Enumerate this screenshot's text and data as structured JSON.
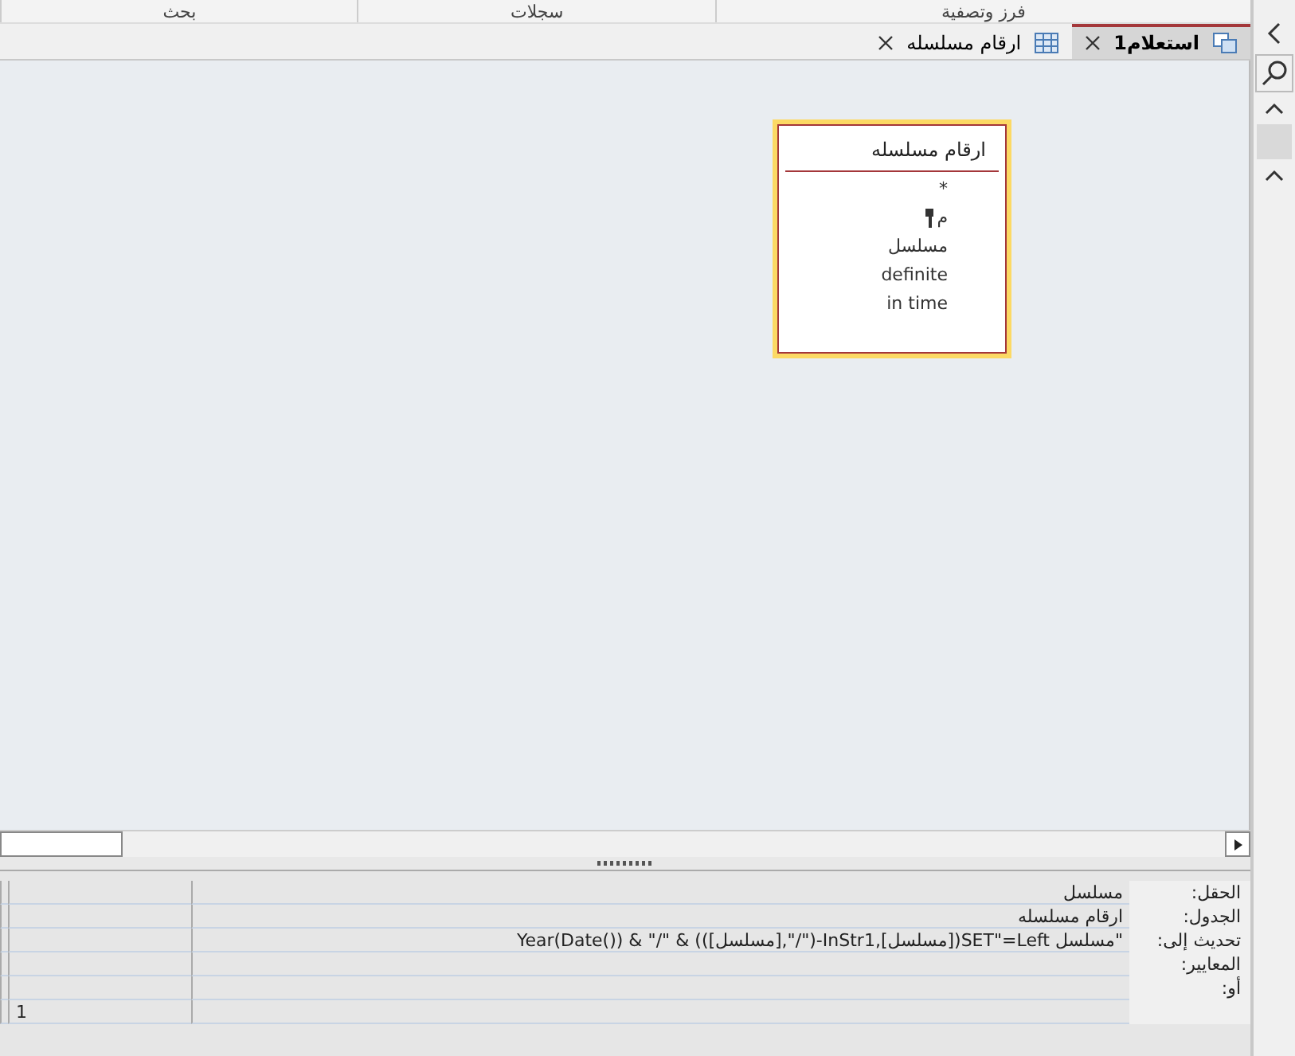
{
  "ribbon_groups": [
    "فرز وتصفية",
    "سجلات",
    "بحث"
  ],
  "tabs": [
    {
      "label": "استعلام1",
      "kind": "query",
      "selected": true
    },
    {
      "label": "ارقام مسلسله",
      "kind": "table",
      "selected": false
    }
  ],
  "field_list": {
    "title": "ارقام مسلسله",
    "fields": [
      {
        "name": "*",
        "primary_key": false
      },
      {
        "name": "م",
        "primary_key": true
      },
      {
        "name": "مسلسل",
        "primary_key": false
      },
      {
        "name": "definite",
        "primary_key": false
      },
      {
        "name": "in time",
        "primary_key": false
      }
    ]
  },
  "grid": {
    "rows": [
      {
        "label": "الحقل:",
        "column_1": "مسلسل",
        "column_2": ""
      },
      {
        "label": "الجدول:",
        "column_1": "ارقام مسلسله",
        "column_2": ""
      },
      {
        "label": "تحديث إلى:",
        "column_1": "\"مسلسل SET\"=Left([مسلسل],InStr1-(\"/\",[مسلسل])) & \"/\" & Year(Date())",
        "column_2": ""
      },
      {
        "label": "المعايير:",
        "column_1": "",
        "column_2": ""
      },
      {
        "label": "أو:",
        "column_1": "",
        "column_2": ""
      },
      {
        "label": "",
        "column_1": "",
        "column_2": "1"
      }
    ]
  }
}
